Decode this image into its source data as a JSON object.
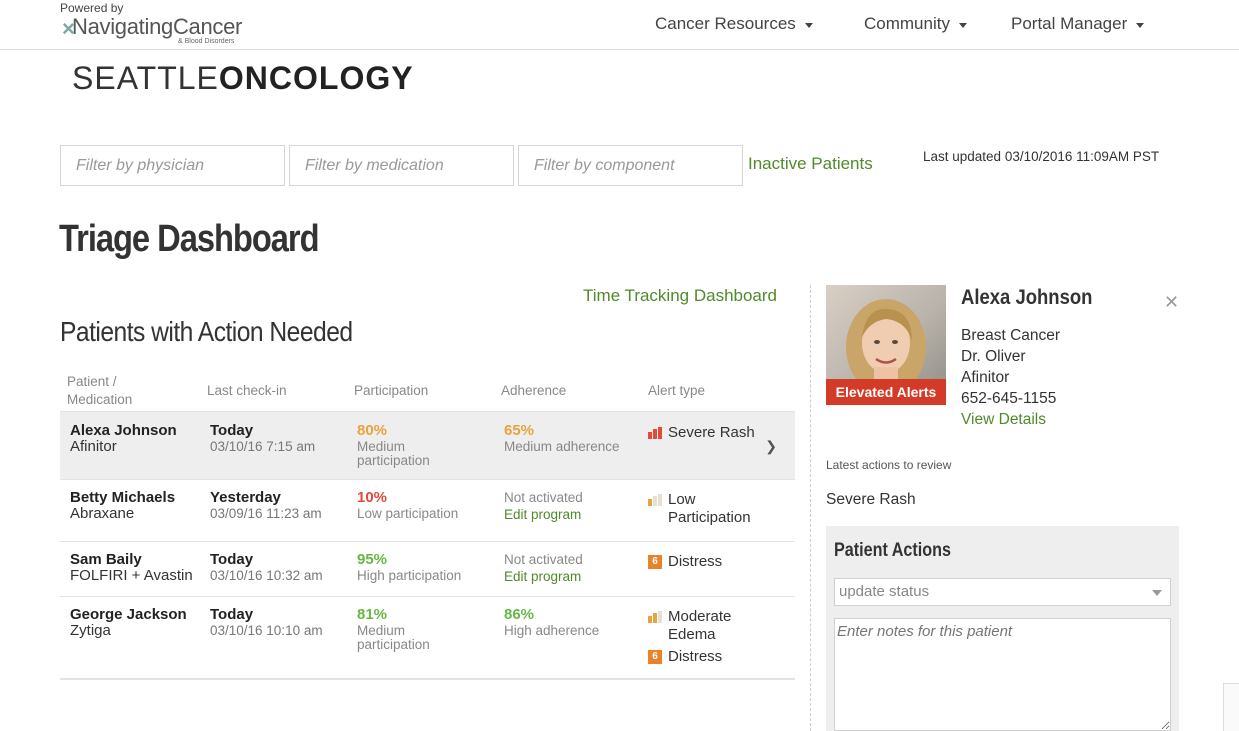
{
  "header": {
    "powered_by": "Powered by",
    "brand_name": "NavigatingCancer",
    "brand_sub": "& Blood Disorders",
    "nav": [
      {
        "label": "Cancer Resources"
      },
      {
        "label": "Community"
      },
      {
        "label": "Portal Manager"
      }
    ]
  },
  "clinic_logo": {
    "light": "SEATTLE",
    "bold": "ONCOLOGY"
  },
  "filters": {
    "physician_placeholder": "Filter by physician",
    "medication_placeholder": "Filter by medication",
    "component_placeholder": "Filter by component",
    "inactive_link": "Inactive Patients",
    "last_updated": "Last updated 03/10/2016 11:09AM PST"
  },
  "page_title": "Triage Dashboard",
  "time_tracking_link": "Time Tracking Dashboard",
  "section_title": "Patients with Action Needed",
  "table": {
    "headers": {
      "patient": "Patient /",
      "medication": "Medication",
      "checkin": "Last check-in",
      "participation": "Participation",
      "adherence": "Adherence",
      "alert": "Alert type"
    },
    "rows": [
      {
        "name": "Alexa Johnson",
        "medication": "Afinitor",
        "checkin_day": "Today",
        "checkin_date": "03/10/16 7:15 am",
        "participation_pct": "80%",
        "participation_label1": "Medium",
        "participation_label2": "participation",
        "adherence_pct": "65%",
        "adherence_label": "Medium adherence",
        "alerts": [
          {
            "label": "Severe Rash",
            "icon": "bar-high-icon"
          }
        ]
      },
      {
        "name": "Betty Michaels",
        "medication": "Abraxane",
        "checkin_day": "Yesterday",
        "checkin_date": "03/09/16 11:23 am",
        "participation_pct": "10%",
        "participation_label1": "Low participation",
        "participation_label2": "",
        "adherence_text": "Not activated",
        "adherence_link": "Edit program",
        "alerts": [
          {
            "label": "Low",
            "label2": "Participation",
            "icon": "bar-low-icon"
          }
        ]
      },
      {
        "name": "Sam Baily",
        "medication": "FOLFIRI + Avastin",
        "checkin_day": "Today",
        "checkin_date": "03/10/16 10:32 am",
        "participation_pct": "95%",
        "participation_label1": "High participation",
        "participation_label2": "",
        "adherence_text": "Not activated",
        "adherence_link": "Edit program",
        "alerts": [
          {
            "label": "Distress",
            "icon": "distress-6-icon",
            "badge": "6"
          }
        ]
      },
      {
        "name": "George Jackson",
        "medication": "Zytiga",
        "checkin_day": "Today",
        "checkin_date": "03/10/16 10:10 am",
        "participation_pct": "81%",
        "participation_label1": "Medium",
        "participation_label2": "participation",
        "adherence_pct": "86%",
        "adherence_label": "High adherence",
        "alerts": [
          {
            "label": "Moderate",
            "label2": "Edema",
            "icon": "bar-medium-icon"
          },
          {
            "label": "Distress",
            "icon": "distress-6-icon",
            "badge": "6"
          }
        ]
      }
    ]
  },
  "patient_panel": {
    "name": "Alexa Johnson",
    "badge": "Elevated Alerts",
    "diagnosis": "Breast Cancer",
    "doctor": "Dr. Oliver",
    "medication": "Afinitor",
    "phone": "652-645-1155",
    "view_details": "View Details",
    "latest_label": "Latest actions to review",
    "latest_item": "Severe Rash",
    "actions_title": "Patient Actions",
    "status_placeholder": "update status",
    "notes_placeholder": "Enter notes for this patient"
  },
  "colors": {
    "accent_green": "#4f8a2b",
    "alert_red": "#d43a28",
    "medium_orange": "#e8a33c",
    "low_red": "#e24b3b",
    "high_green": "#66b845",
    "distress_orange": "#e8832a"
  }
}
